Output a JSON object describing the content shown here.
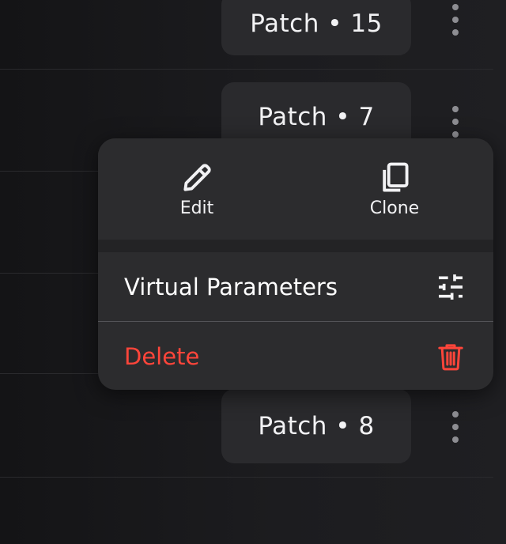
{
  "rows": [
    {
      "label": "Patch • 15"
    },
    {
      "label": "Patch • 7"
    },
    {
      "label": "Patch • 8"
    }
  ],
  "menu": {
    "edit_label": "Edit",
    "clone_label": "Clone",
    "virtual_parameters_label": "Virtual Parameters",
    "delete_label": "Delete"
  },
  "colors": {
    "background": "#1b1b1d",
    "pill": "#2a2a2d",
    "menu": "#2c2c2e",
    "delete": "#ff453a",
    "text": "#f2f2f4"
  },
  "icons": {
    "edit": "pencil-icon",
    "clone": "copy-icon",
    "virtual_parameters": "sliders-icon",
    "delete": "trash-icon",
    "more": "more-vertical-icon"
  }
}
